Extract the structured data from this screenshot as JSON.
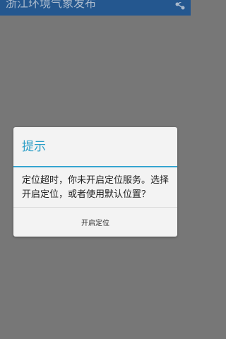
{
  "app_bar": {
    "title": "浙江环境气象发布",
    "share_icon": "share-icon",
    "background": "#24578f"
  },
  "dialog": {
    "title": "提示",
    "message": "定位超时，你未开启定位服务。选择开启定位，或者使用默认位置？",
    "button_label": "开启定位",
    "accent": "#2a9ec7"
  },
  "overlay_color": "#777777"
}
